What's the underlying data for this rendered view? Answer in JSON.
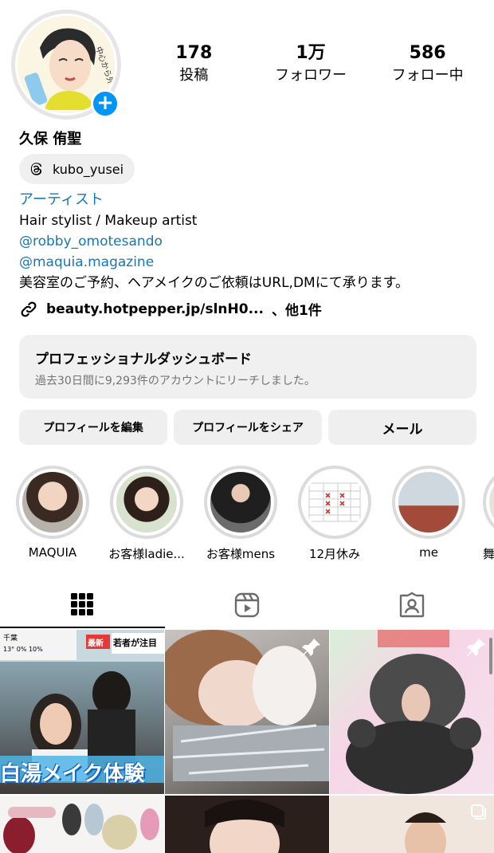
{
  "profile": {
    "name": "久保 侑聖",
    "threads_handle": "kubo_yusei",
    "avatar_text": "中心から外"
  },
  "stats": [
    {
      "value": "178",
      "label": "投稿"
    },
    {
      "value": "1万",
      "label": "フォロワー"
    },
    {
      "value": "586",
      "label": "フォロー中"
    }
  ],
  "bio": {
    "category": "アーティスト",
    "line1": "Hair stylist / Makeup artist",
    "mention1": "@robby_omotesando",
    "mention2": "@maquia.magazine",
    "line2": "美容室のご予約、ヘアメイクのご依頼はURL,DMにて承ります。",
    "link": "beauty.hotpepper.jp/slnH0...",
    "link_more": "、他1件"
  },
  "dashboard": {
    "title": "プロフェッショナルダッシュボード",
    "subtitle": "過去30日間に9,293件のアカウントにリーチしました。"
  },
  "buttons": {
    "edit": "プロフィールを編集",
    "share": "プロフィールをシェア",
    "mail": "メール"
  },
  "highlights": [
    {
      "label": "MAQUIA"
    },
    {
      "label": "お客様ladie..."
    },
    {
      "label": "お客様mens"
    },
    {
      "label": "12月休み"
    },
    {
      "label": "me"
    },
    {
      "label": "舞"
    }
  ],
  "posts": {
    "post1_badge": "最新",
    "post1_top": "若者が注目",
    "post1_caption": "白湯メイク体験",
    "post1_weather_city": "千葉",
    "post1_weather": "13° 0% 10%"
  },
  "colors": {
    "accent": "#0095f6",
    "link": "#1677b5",
    "button_bg": "#efefef"
  },
  "icons": {
    "grid": "grid-icon",
    "reels": "reels-icon",
    "tagged": "tagged-icon",
    "pin": "pin-icon",
    "link": "link-icon",
    "threads": "threads-icon"
  }
}
